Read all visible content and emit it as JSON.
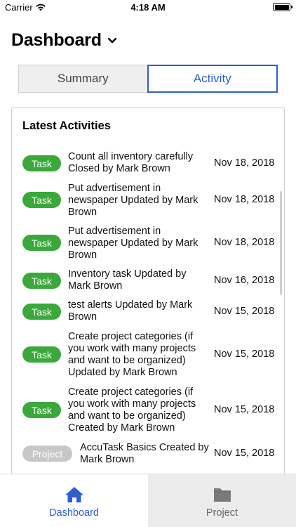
{
  "status_bar": {
    "carrier": "Carrier",
    "time": "4:18 AM"
  },
  "header": {
    "title": "Dashboard"
  },
  "segments": {
    "summary": "Summary",
    "activity": "Activity",
    "selected": "Activity"
  },
  "card": {
    "title": "Latest Activities",
    "activities": [
      {
        "type": "Task",
        "text": "Count all inventory carefully Closed by Mark Brown",
        "date": "Nov 18, 2018"
      },
      {
        "type": "Task",
        "text": "Put advertisement in newspaper Updated by Mark Brown",
        "date": "Nov 18, 2018"
      },
      {
        "type": "Task",
        "text": "Put advertisement in newspaper Updated by Mark Brown",
        "date": "Nov 18, 2018"
      },
      {
        "type": "Task",
        "text": "Inventory task Updated by Mark Brown",
        "date": "Nov 16, 2018"
      },
      {
        "type": "Task",
        "text": "test alerts Updated by Mark Brown",
        "date": "Nov 15, 2018"
      },
      {
        "type": "Task",
        "text": "Create project categories (if you work with many projects and want to be organized) Updated by Mark Brown",
        "date": "Nov 15, 2018"
      },
      {
        "type": "Task",
        "text": "Create project categories (if you work with many projects and want to be organized) Created by Mark Brown",
        "date": "Nov 15, 2018"
      },
      {
        "type": "Project",
        "text": "AccuTask Basics Created by Mark Brown",
        "date": "Nov 15, 2018"
      }
    ]
  },
  "tab_bar": {
    "items": [
      {
        "label": "Dashboard",
        "icon": "home-icon",
        "selected": true
      },
      {
        "label": "Project",
        "icon": "folder-icon",
        "selected": false
      }
    ]
  },
  "colors": {
    "accent": "#2d5fcf",
    "task_badge": "#3aa83a",
    "project_badge": "#c7c7c7"
  }
}
